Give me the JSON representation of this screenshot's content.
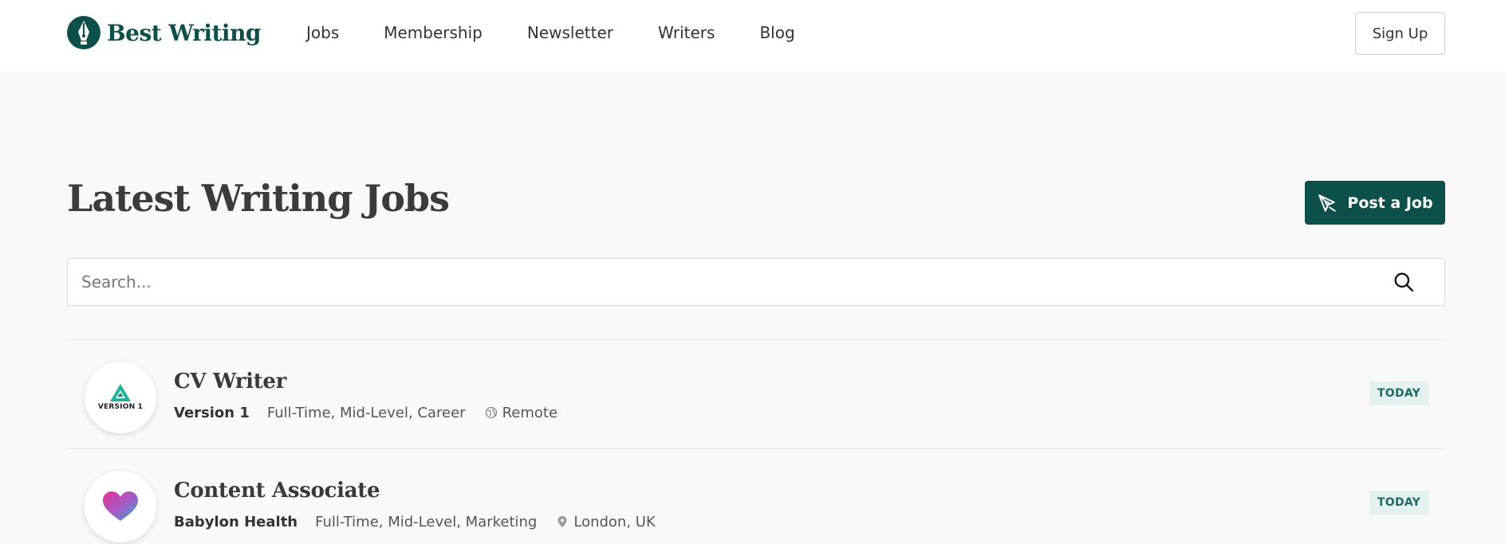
{
  "header": {
    "brand": "Best Writing",
    "nav": [
      "Jobs",
      "Membership",
      "Newsletter",
      "Writers",
      "Blog"
    ],
    "signup_label": "Sign Up"
  },
  "main": {
    "title": "Latest Writing Jobs",
    "post_job_label": "Post a Job",
    "search": {
      "placeholder": "Search...",
      "value": ""
    }
  },
  "jobs": [
    {
      "title": "CV Writer",
      "company": "Version 1",
      "logo_text": "VERSION 1",
      "tags": "Full-Time, Mid-Level, Career",
      "location": "Remote",
      "location_icon": "globe-icon",
      "badge": "TODAY"
    },
    {
      "title": "Content Associate",
      "company": "Babylon Health",
      "tags": "Full-Time, Mid-Level, Marketing",
      "location": "London, UK",
      "location_icon": "map-pin-icon",
      "badge": "TODAY"
    }
  ],
  "colors": {
    "brand": "#0d4f49",
    "page_bg": "#f9f9f9",
    "badge_bg": "#e4f1ef",
    "badge_text": "#1f6b62"
  }
}
